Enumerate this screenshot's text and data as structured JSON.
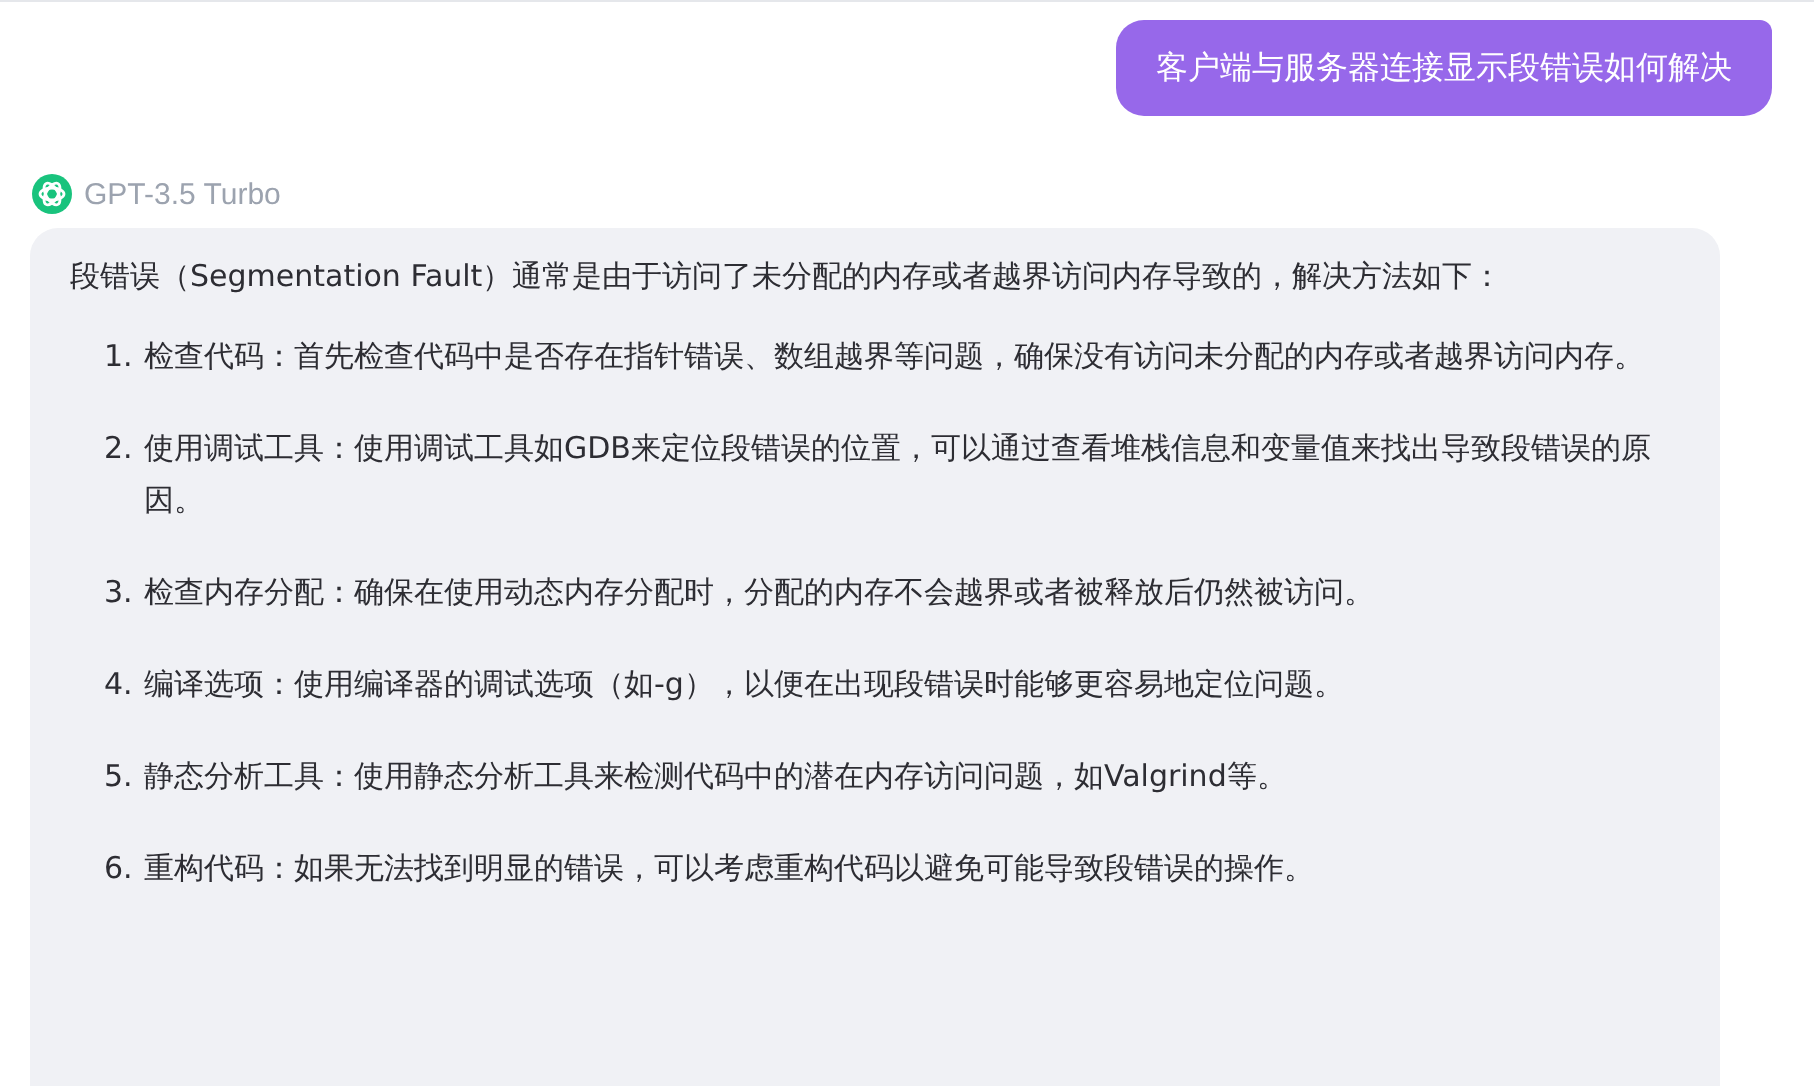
{
  "user_message": "客户端与服务器连接显示段错误如何解决",
  "model": {
    "name": "GPT-3.5 Turbo"
  },
  "answer": {
    "intro": "段错误（Segmentation Fault）通常是由于访问了未分配的内存或者越界访问内存导致的，解决方法如下：",
    "items": [
      {
        "number": "1.",
        "text": "检查代码：首先检查代码中是否存在指针错误、数组越界等问题，确保没有访问未分配的内存或者越界访问内存。"
      },
      {
        "number": "2.",
        "text": "使用调试工具：使用调试工具如GDB来定位段错误的位置，可以通过查看堆栈信息和变量值来找出导致段错误的原因。"
      },
      {
        "number": "3.",
        "text": "检查内存分配：确保在使用动态内存分配时，分配的内存不会越界或者被释放后仍然被访问。"
      },
      {
        "number": "4.",
        "text": "编译选项：使用编译器的调试选项（如-g），以便在出现段错误时能够更容易地定位问题。"
      },
      {
        "number": "5.",
        "text": "静态分析工具：使用静态分析工具来检测代码中的潜在内存访问问题，如Valgrind等。"
      },
      {
        "number": "6.",
        "text": "重构代码：如果无法找到明显的错误，可以考虑重构代码以避免可能导致段错误的操作。"
      }
    ]
  }
}
